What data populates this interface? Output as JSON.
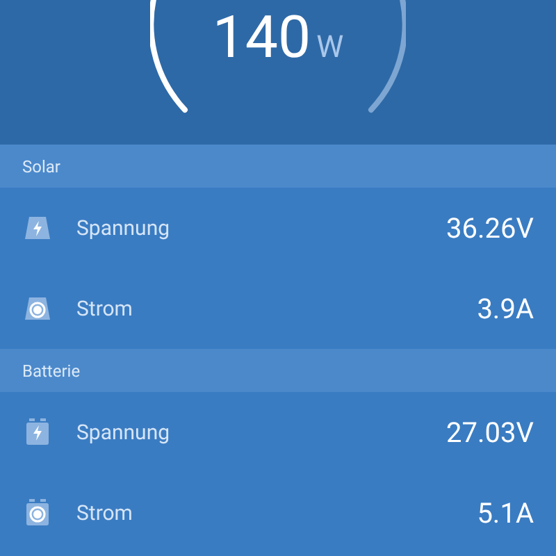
{
  "gauge": {
    "value": "140",
    "unit": "W"
  },
  "sections": [
    {
      "title": "Solar",
      "kind": "panel",
      "rows": [
        {
          "kind": "voltage",
          "label": "Spannung",
          "value": "36.26V"
        },
        {
          "kind": "current",
          "label": "Strom",
          "value": "3.9A"
        }
      ]
    },
    {
      "title": "Batterie",
      "kind": "battery",
      "rows": [
        {
          "kind": "voltage",
          "label": "Spannung",
          "value": "27.03V"
        },
        {
          "kind": "current",
          "label": "Strom",
          "value": "5.1A"
        }
      ]
    }
  ]
}
